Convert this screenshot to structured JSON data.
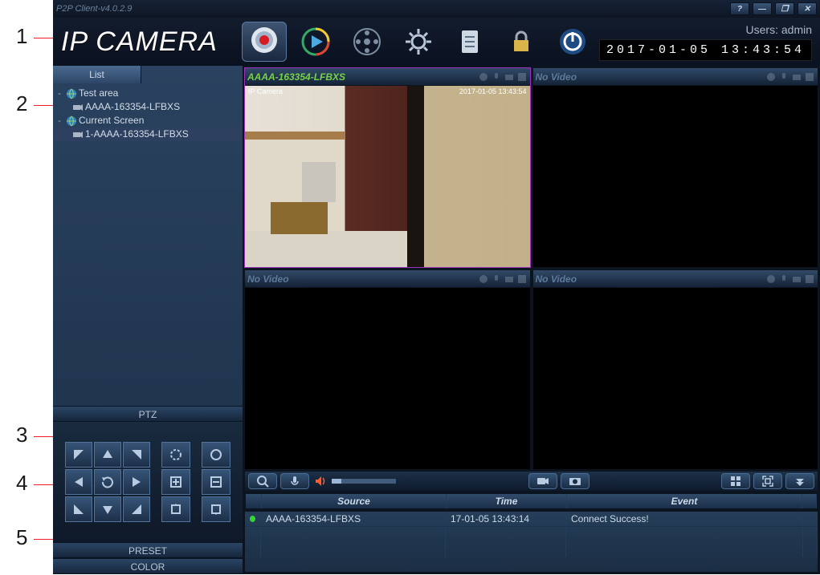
{
  "titlebar": {
    "title": "P2P Client-v4.0.2.9"
  },
  "header": {
    "brand": "IP CAMERA",
    "user_label": "Users: admin",
    "clock": "2017-01-05 13:43:54"
  },
  "sidebar": {
    "tabs": [
      "List"
    ],
    "tree": {
      "area_label": "Test area",
      "dev1": "AAAA-163354-LFBXS",
      "cs_label": "Current Screen",
      "dev2": "1-AAAA-163354-LFBXS"
    },
    "ptz_header": "PTZ",
    "preset_header": "PRESET",
    "color_header": "COLOR"
  },
  "tiles": [
    {
      "title": "AAAA-163354-LFBXS",
      "no_video": false,
      "osd_left": "IP Camera",
      "osd_right": "2017-01-05 13:43:54"
    },
    {
      "title": "No Video",
      "no_video": true
    },
    {
      "title": "No Video",
      "no_video": true
    },
    {
      "title": "No Video",
      "no_video": true
    }
  ],
  "log": {
    "headers": {
      "source": "Source",
      "time": "Time",
      "event": "Event"
    },
    "rows": [
      {
        "source": "AAAA-163354-LFBXS",
        "time": "17-01-05 13:43:14",
        "event": "Connect Success!"
      }
    ]
  },
  "callouts": {
    "c1": "1",
    "c2": "2",
    "c3": "3",
    "c4": "4",
    "c5": "5"
  }
}
